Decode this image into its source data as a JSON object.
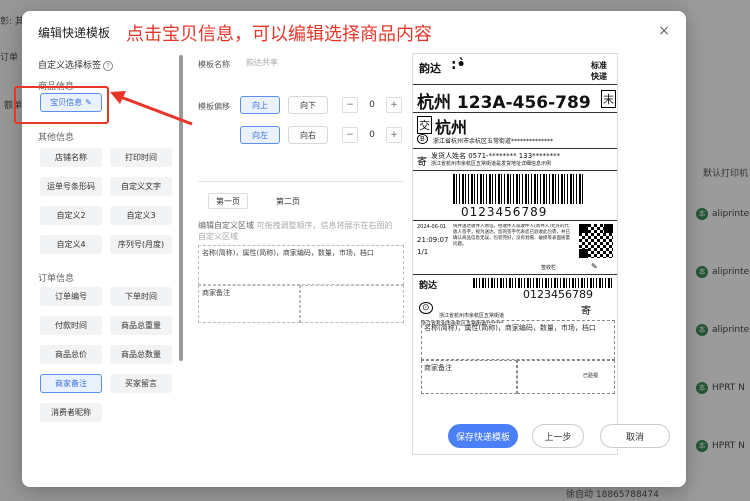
{
  "background": {
    "top_left_text": "彰: 其",
    "order_label": "订单",
    "left_label2": "额单",
    "column_header": "默认打印机",
    "rows": [
      "aliprinte",
      "aliprinte",
      "aliprinte",
      "HPRT N",
      "HPRT N"
    ],
    "badge_char": "本",
    "footer_text": "徐自动 18865788474"
  },
  "modal": {
    "title": "编辑快递模板",
    "close": "×",
    "annotation": "点击宝贝信息，可以编辑选择商品内容"
  },
  "left_panel": {
    "select_tags_label": "自定义选择标签",
    "product_info_title": "商品信息",
    "product_tag": "宝贝信息",
    "other_info_title": "其他信息",
    "other_tags": [
      "店铺名称",
      "打印时间",
      "运单号条形码",
      "自定义文字",
      "自定义2",
      "自定义3",
      "自定义4",
      "序列号(月度)"
    ],
    "order_info_title": "订单信息",
    "order_tags": [
      "订单编号",
      "下单时间",
      "付款时间",
      "商品总重量",
      "商品总价",
      "商品总数量",
      "商家备注",
      "买家留言",
      "消费者昵称"
    ]
  },
  "middle_panel": {
    "template_name_label": "模板名称",
    "template_name_value": "韵达共享",
    "offset_label": "模板偏移",
    "up": "向上",
    "down": "向下",
    "left": "向左",
    "right": "向右",
    "minus": "−",
    "plus": "+",
    "offset_v": "0",
    "offset_h": "0",
    "tab1": "第一页",
    "tab2": "第二页",
    "desc": "编辑自定义区域",
    "desc_hint": "可拖拽调整顺序，信息将展示在右图的",
    "desc_tail": "自定义区域",
    "area1_text": "名称(简称)，属性(简称)，商家编码，数量，市场，档口",
    "area2_text": "商家备注"
  },
  "preview": {
    "brand": "韵达",
    "standard": "标准",
    "express": "快递",
    "route": "杭州 123A-456-789",
    "mo": "末",
    "jiao": "交",
    "city": "杭州",
    "b": "B",
    "addr1": "浙江省杭州市余杭区五常街道**************",
    "ji": "寄",
    "sender": "发货人姓名  0571-********  133********",
    "sender_addr": "浙江省杭州市余杭区五常街道是发货地址详细信息示例",
    "tracking": "0123456789",
    "date": "2024-06-01",
    "time": "21:09:07",
    "count": "1/1",
    "terms": "快件送达收件人地址，经收件人或收件人(寄件人)允许的代收人签字，视为送达。您的签字代表您已验收此包裹，并已确认商品信息无误，包装完好，没有划痕、破损等表面质量问题。",
    "sign": "签收栏",
    "tracking2": "0123456789",
    "addr2": "浙江省杭州市余杭区五常街道",
    "addr2b": "浙江省杭州市余杭区五常街道*******",
    "item_area": "名称(简称)，属性(简称)，商家编码，数量，市场，档口",
    "remark": "商家备注",
    "printed": "已验视"
  },
  "footer": {
    "save": "保存快递模板",
    "prev": "上一步",
    "cancel": "取消"
  },
  "colors": {
    "primary": "#4a7ff7",
    "annotation_red": "#e8352a"
  }
}
